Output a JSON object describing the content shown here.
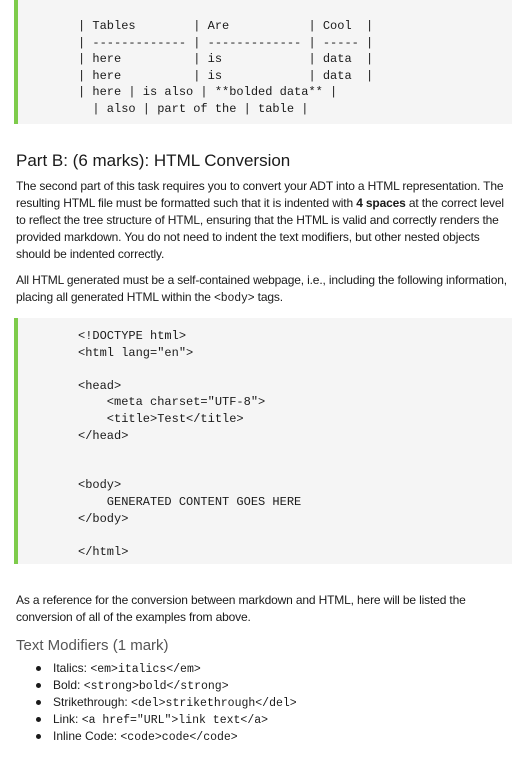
{
  "table_code": {
    "lines": [
      "| Tables        | Are           | Cool  |",
      "| ------------- | ------------- | ----- |",
      "| here          | is            | data  |",
      "| here          | is            | data  |",
      "| here | is also | **bolded data** |",
      "  | also | part of the | table |"
    ]
  },
  "part_b": {
    "title": "Part B: (6 marks): HTML Conversion",
    "para1_before": "The second part of this task requires you to convert your ADT into a HTML representation. The resulting HTML file must be formatted such that it is indented with ",
    "para1_bold": "4 spaces",
    "para1_after": " at the correct level to reflect the tree structure of HTML, ensuring that the HTML is valid and correctly renders the provided markdown. You do not need to indent the text modifiers, but other nested objects should be indented correctly.",
    "para2_before": "All HTML generated must be a self-contained webpage, i.e., including the following information, placing all generated HTML within the ",
    "para2_code": "<body>",
    "para2_after": " tags."
  },
  "html_code": {
    "lines": [
      "<!DOCTYPE html>",
      "<html lang=\"en\">",
      "",
      "<head>",
      "    <meta charset=\"UTF-8\">",
      "    <title>Test</title>",
      "</head>",
      "",
      "",
      "<body>",
      "    GENERATED CONTENT GOES HERE",
      "</body>",
      "",
      "</html>"
    ]
  },
  "reference_para": "As a reference for the conversion between markdown and HTML, here will be listed the conversion of all of the examples from above.",
  "text_modifiers": {
    "title": "Text Modifiers (1 mark)",
    "items": [
      {
        "label": "Italics: ",
        "code": "<em>italics</em>"
      },
      {
        "label": "Bold: ",
        "code": "<strong>bold</strong>"
      },
      {
        "label": "Strikethrough: ",
        "code": "<del>strikethrough</del>"
      },
      {
        "label": "Link: ",
        "code": "<a href=\"URL\">link text</a>"
      },
      {
        "label": "Inline Code: ",
        "code": "<code>code</code>"
      }
    ]
  },
  "colors": {
    "code_background": "#f5f5f5",
    "code_border": "#7ecb4b",
    "subheading": "#555555"
  }
}
